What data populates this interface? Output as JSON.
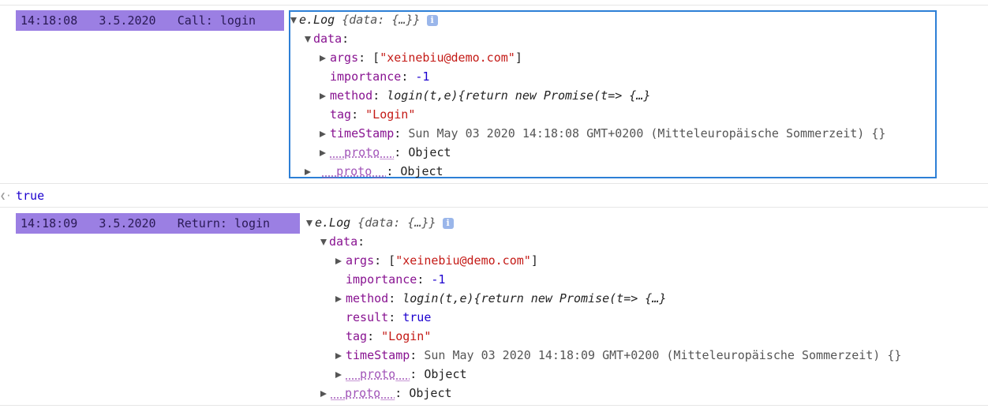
{
  "entries": [
    {
      "time": "14:18:08",
      "date": "3.5.2020",
      "label": "Call: login",
      "header": "e.Log",
      "header_preview": "{data: {…}}",
      "data_key": "data",
      "args_key": "args",
      "args_value": "\"xeinebiu@demo.com\"",
      "importance_key": "importance",
      "importance_value": "-1",
      "method_key": "method",
      "method_value": "login(t,e){return new Promise(t=> {…}",
      "tag_key": "tag",
      "tag_value": "\"Login\"",
      "timestamp_key": "timeStamp",
      "timestamp_value": "Sun May 03 2020 14:18:08 GMT+0200 (Mitteleuropäische Sommerzeit) {}",
      "proto_key": "__proto__",
      "proto_value": "Object",
      "outer_proto_key": "__proto__",
      "outer_proto_value": "Object"
    },
    {
      "time": "14:18:09",
      "date": "3.5.2020",
      "label": "Return: login",
      "header": "e.Log",
      "header_preview": "{data: {…}}",
      "data_key": "data",
      "args_key": "args",
      "args_value": "\"xeinebiu@demo.com\"",
      "importance_key": "importance",
      "importance_value": "-1",
      "method_key": "method",
      "method_value": "login(t,e){return new Promise(t=> {…}",
      "result_key": "result",
      "result_value": "true",
      "tag_key": "tag",
      "tag_value": "\"Login\"",
      "timestamp_key": "timeStamp",
      "timestamp_value": "Sun May 03 2020 14:18:09 GMT+0200 (Mitteleuropäische Sommerzeit) {}",
      "proto_key": "__proto__",
      "proto_value": "Object",
      "outer_proto_key": "__proto__",
      "outer_proto_value": "Object"
    }
  ],
  "return_value": "true",
  "icons": {
    "info": "info-icon",
    "return": "return-arrow-icon"
  },
  "colors": {
    "badge": "#9b7fe3",
    "highlight": "#2d7fd6",
    "key": "#881391",
    "string": "#c41a16",
    "number": "#1c00cf"
  }
}
